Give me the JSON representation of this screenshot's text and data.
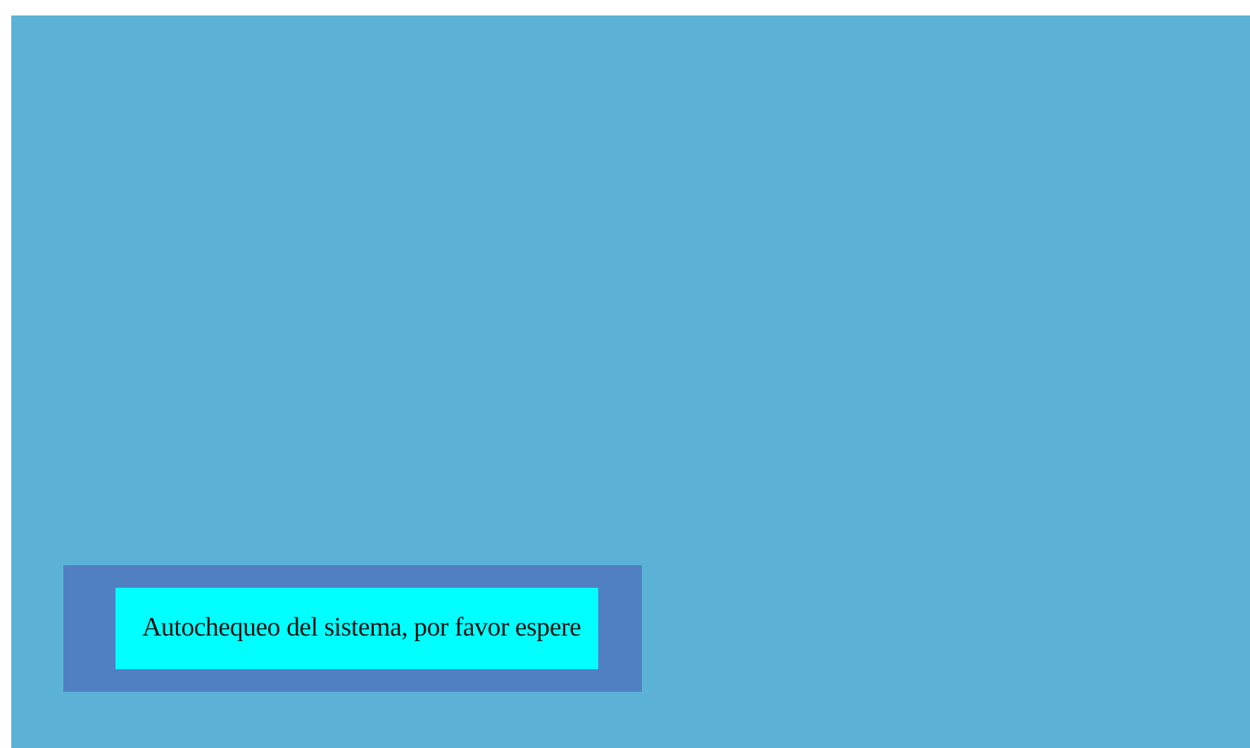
{
  "status_message": {
    "text": "Autochequeo del sistema, por favor espere"
  }
}
